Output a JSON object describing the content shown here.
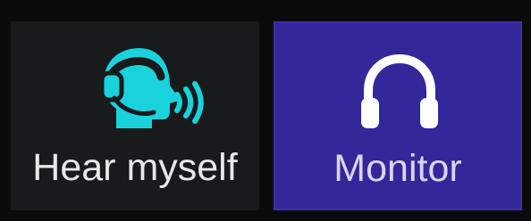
{
  "buttons": {
    "hear_myself": {
      "label": "Hear myself",
      "icon": "speaking-head-headset-icon",
      "icon_color": "#19d2dc",
      "background": "#181a1c"
    },
    "monitor": {
      "label": "Monitor",
      "icon": "headphones-icon",
      "icon_color": "#ffffff",
      "background": "#33279a",
      "selected": true
    }
  }
}
